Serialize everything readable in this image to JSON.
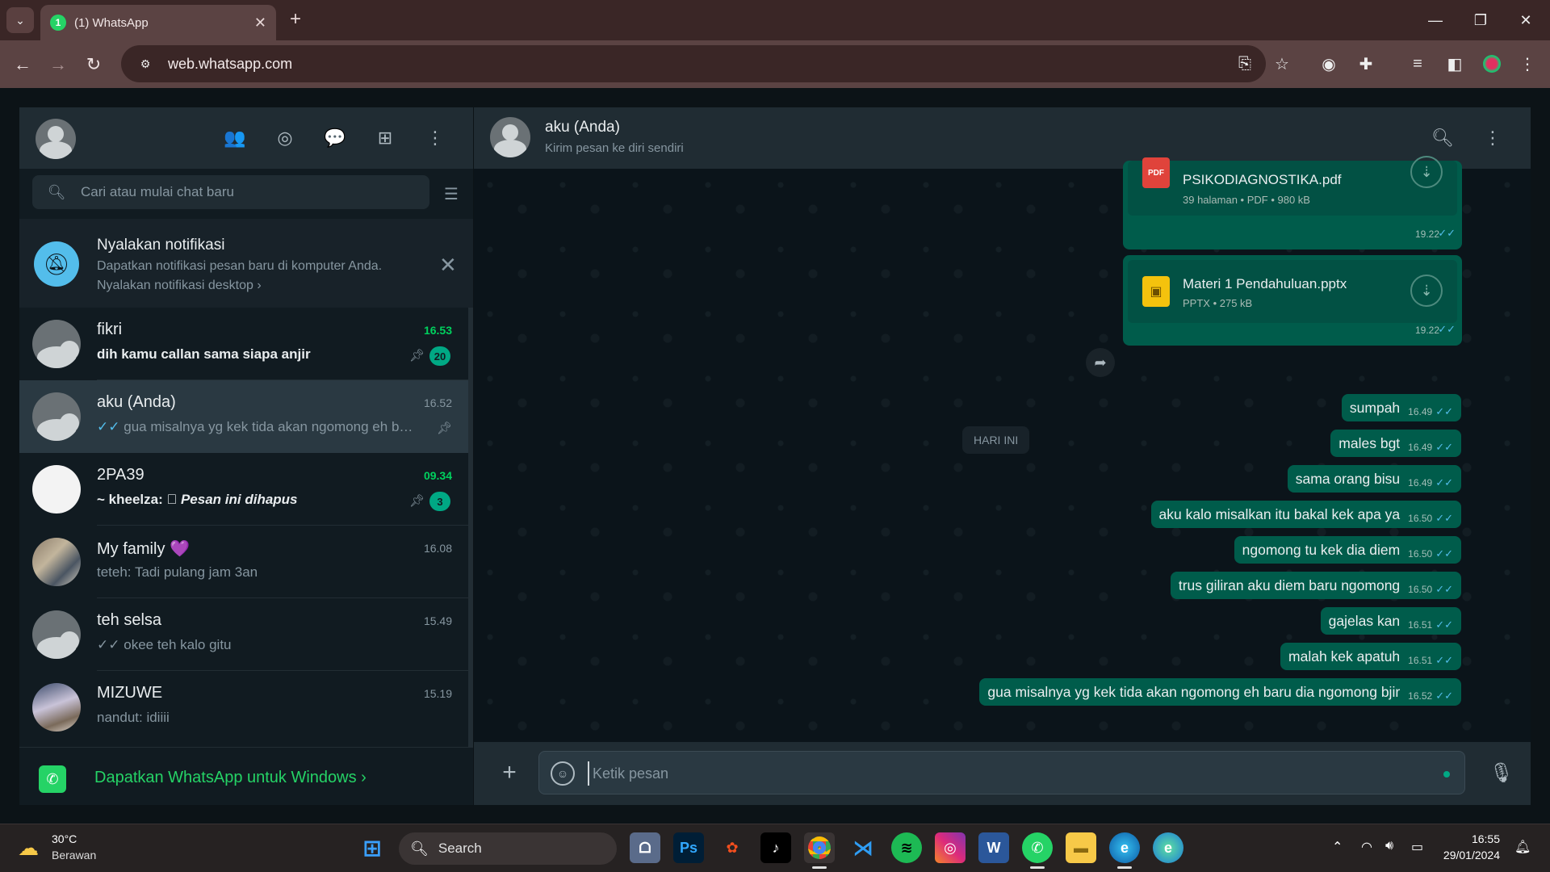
{
  "browser": {
    "tab_title": "(1) WhatsApp",
    "tab_badge": "1",
    "url": "web.whatsapp.com"
  },
  "sidebar": {
    "search_placeholder": "Cari atau mulai chat baru",
    "notification": {
      "title": "Nyalakan notifikasi",
      "description": "Dapatkan notifikasi pesan baru di komputer Anda.",
      "link": "Nyalakan notifikasi desktop ›"
    },
    "chats": [
      {
        "name": "fikri",
        "time": "16.53",
        "preview": "dih kamu callan sama siapa anjir",
        "unread": "20",
        "pinned": true
      },
      {
        "name": "aku (Anda)",
        "time": "16.52",
        "preview": "gua misalnya yg kek tida akan ngomong eh baru dia ngomong bjir",
        "ticks": "✓✓",
        "pinned": true
      },
      {
        "name": "2PA39",
        "time": "09.34",
        "sender": "~ kheelza:",
        "preview": "Pesan ini dihapus",
        "unread": "3",
        "pinned": true
      },
      {
        "name": "My family",
        "emoji": "💜",
        "time": "16.08",
        "preview": "teteh: Tadi pulang jam 3an"
      },
      {
        "name": "teh selsa",
        "time": "15.49",
        "preview": "okee teh kalo gitu",
        "ticks": "✓✓"
      },
      {
        "name": "MIZUWE",
        "time": "15.19",
        "preview": "nandut: idiiii"
      }
    ],
    "get_app": "Dapatkan WhatsApp untuk Windows ›"
  },
  "conversation": {
    "title": "aku (Anda)",
    "subtitle": "Kirim pesan ke diri sendiri",
    "documents": [
      {
        "icon_label": "PDF",
        "name": "PSIKODIAGNOSTIKA.pdf",
        "meta": "39 halaman • PDF • 980 kB",
        "time": "19.22"
      },
      {
        "icon_label": "▣",
        "name": "Materi 1 Pendahuluan.pptx",
        "meta": "PPTX • 275 kB",
        "time": "19.22"
      }
    ],
    "date_divider": "HARI INI",
    "messages": [
      {
        "text": "sumpah",
        "time": "16.49"
      },
      {
        "text": "males bgt",
        "time": "16.49"
      },
      {
        "text": "sama orang bisu",
        "time": "16.49"
      },
      {
        "text": "aku kalo misalkan itu bakal kek apa ya",
        "time": "16.50"
      },
      {
        "text": "ngomong tu kek dia diem",
        "time": "16.50"
      },
      {
        "text": "trus giliran aku diem baru ngomong",
        "time": "16.50"
      },
      {
        "text": "gajelas kan",
        "time": "16.51"
      },
      {
        "text": "malah kek apatuh",
        "time": "16.51"
      },
      {
        "text": "gua misalnya yg kek tida akan ngomong eh baru dia ngomong bjir",
        "time": "16.52"
      }
    ],
    "composer_placeholder": "Ketik pesan"
  },
  "taskbar": {
    "weather_temp": "30°C",
    "weather_desc": "Berawan",
    "search_label": "Search",
    "clock_time": "16:55",
    "clock_date": "29/01/2024"
  },
  "colors": {
    "accent": "#00a884",
    "outgoing_bubble": "#005c4b",
    "read_ticks": "#53bdeb",
    "browser_frame": "#5b4343"
  }
}
